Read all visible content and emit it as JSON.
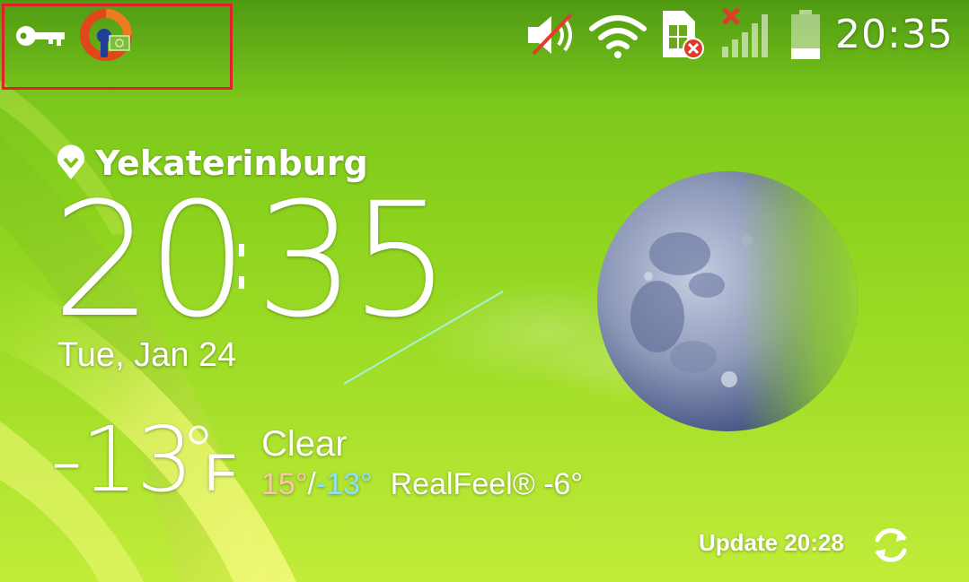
{
  "status_bar": {
    "time": "20:35",
    "notifications": [
      "key-icon",
      "vpn-app-icon"
    ],
    "indicators": [
      "volume-muted-icon",
      "wifi-icon",
      "sim-error-icon",
      "no-signal-icon",
      "battery-icon"
    ]
  },
  "weather": {
    "location": "Yekaterinburg",
    "clock_hours": "20",
    "clock_minutes": "35",
    "date": "Tue, Jan 24",
    "temperature": "-13",
    "unit": "F",
    "condition": "Clear",
    "high": "15°",
    "separator": "/",
    "low": "-13°",
    "realfeel": "RealFeel® -6°",
    "update": "Update 20:28"
  },
  "colors": {
    "highlight_box": "#e0202a",
    "high_temp": "#f7c9a6",
    "low_temp": "#8de0f5",
    "mute_slash": "#e63a2c"
  }
}
